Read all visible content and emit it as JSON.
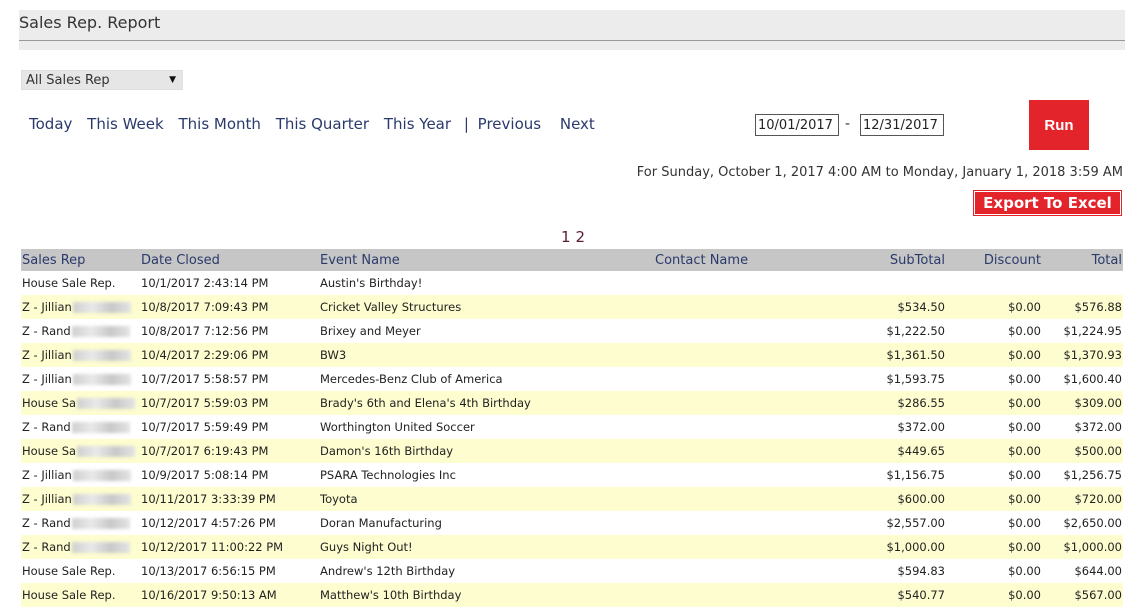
{
  "header": {
    "title": "Sales Rep. Report"
  },
  "filters": {
    "sales_rep_selected": "All Sales Rep",
    "ranges": [
      "Today",
      "This Week",
      "This Month",
      "This Quarter",
      "This Year"
    ],
    "separator": "|",
    "previous_label": "Previous",
    "next_label": "Next",
    "start_date": "10/01/2017",
    "end_date": "12/31/2017",
    "date_dash": "-",
    "run_label": "Run"
  },
  "period_text": "For Sunday, October 1, 2017 4:00 AM to Monday, January 1, 2018 3:59 AM",
  "export_label": "Export To Excel",
  "pager": [
    "1",
    "2"
  ],
  "table": {
    "columns": [
      "Sales Rep",
      "Date Closed",
      "Event Name",
      "Contact Name",
      "SubTotal",
      "Discount",
      "Total"
    ],
    "rows": [
      {
        "rep": "House Sale Rep.",
        "date": "10/1/2017 2:43:14 PM",
        "event": "Austin's Birthday!",
        "contact": "",
        "subtotal": "",
        "discount": "",
        "total": ""
      },
      {
        "rep": "Z - Jillian",
        "redacted": true,
        "date": "10/8/2017 7:09:43 PM",
        "event": "Cricket Valley Structures",
        "contact": "",
        "subtotal": "$534.50",
        "discount": "$0.00",
        "total": "$576.88"
      },
      {
        "rep": "Z - Rand",
        "redacted": true,
        "date": "10/8/2017 7:12:56 PM",
        "event": "Brixey and Meyer",
        "contact": "",
        "subtotal": "$1,222.50",
        "discount": "$0.00",
        "total": "$1,224.95"
      },
      {
        "rep": "Z - Jillian",
        "redacted": true,
        "date": "10/4/2017 2:29:06 PM",
        "event": "BW3",
        "contact": "",
        "subtotal": "$1,361.50",
        "discount": "$0.00",
        "total": "$1,370.93"
      },
      {
        "rep": "Z - Jillian",
        "redacted": true,
        "date": "10/7/2017 5:58:57 PM",
        "event": "Mercedes-Benz Club of America",
        "contact": "",
        "subtotal": "$1,593.75",
        "discount": "$0.00",
        "total": "$1,600.40"
      },
      {
        "rep": "House Sa",
        "redacted": true,
        "date": "10/7/2017 5:59:03 PM",
        "event": "Brady's 6th and Elena's 4th Birthday",
        "contact": "",
        "subtotal": "$286.55",
        "discount": "$0.00",
        "total": "$309.00"
      },
      {
        "rep": "Z - Rand",
        "redacted": true,
        "date": "10/7/2017 5:59:49 PM",
        "event": "Worthington United Soccer",
        "contact": "",
        "subtotal": "$372.00",
        "discount": "$0.00",
        "total": "$372.00"
      },
      {
        "rep": "House Sa",
        "redacted": true,
        "date": "10/7/2017 6:19:43 PM",
        "event": "Damon's 16th Birthday",
        "contact": "",
        "subtotal": "$449.65",
        "discount": "$0.00",
        "total": "$500.00"
      },
      {
        "rep": "Z - Jillian",
        "redacted": true,
        "date": "10/9/2017 5:08:14 PM",
        "event": "PSARA Technologies Inc",
        "contact": "",
        "subtotal": "$1,156.75",
        "discount": "$0.00",
        "total": "$1,256.75"
      },
      {
        "rep": "Z - Jillian",
        "redacted": true,
        "date": "10/11/2017 3:33:39 PM",
        "event": "Toyota",
        "contact": "",
        "subtotal": "$600.00",
        "discount": "$0.00",
        "total": "$720.00"
      },
      {
        "rep": "Z - Rand",
        "redacted": true,
        "date": "10/12/2017 4:57:26 PM",
        "event": "Doran Manufacturing",
        "contact": "",
        "subtotal": "$2,557.00",
        "discount": "$0.00",
        "total": "$2,650.00"
      },
      {
        "rep": "Z - Rand",
        "redacted": true,
        "date": "10/12/2017 11:00:22 PM",
        "event": "Guys Night Out!",
        "contact": "",
        "subtotal": "$1,000.00",
        "discount": "$0.00",
        "total": "$1,000.00"
      },
      {
        "rep": "House Sale Rep.",
        "date": "10/13/2017 6:56:15 PM",
        "event": "Andrew's 12th Birthday",
        "contact": "",
        "subtotal": "$594.83",
        "discount": "$0.00",
        "total": "$644.00"
      },
      {
        "rep": "House Sale Rep.",
        "date": "10/16/2017 9:50:13 AM",
        "event": "Matthew's 10th Birthday",
        "contact": "",
        "subtotal": "$540.77",
        "discount": "$0.00",
        "total": "$567.00"
      }
    ]
  }
}
